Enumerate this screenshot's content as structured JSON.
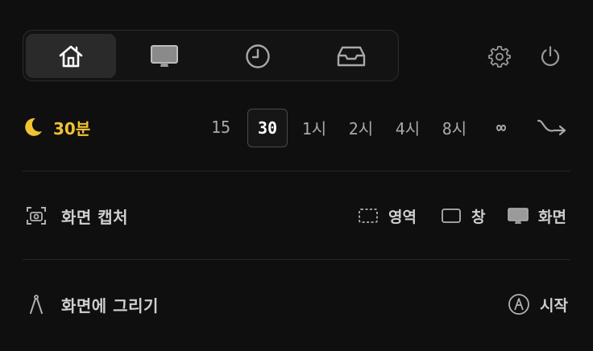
{
  "tabs": [
    {
      "name": "home",
      "icon": "home-icon",
      "active": true
    },
    {
      "name": "display",
      "icon": "monitor-icon",
      "active": false
    },
    {
      "name": "history",
      "icon": "clock-icon",
      "active": false
    },
    {
      "name": "inbox",
      "icon": "inbox-tray-icon",
      "active": false
    }
  ],
  "header": {
    "settings_icon": "gear-icon",
    "power_icon": "power-icon"
  },
  "timer": {
    "icon": "moon-icon",
    "current_label": "30분",
    "options": [
      "15",
      "30",
      "1시",
      "2시",
      "4시",
      "8시",
      "∞"
    ],
    "selected": "30",
    "schedule_icon": "schedule-curve-icon"
  },
  "capture": {
    "icon": "camera-icon",
    "label": "화면 캡처",
    "actions": [
      {
        "icon": "dashed-rect-icon",
        "label": "영역"
      },
      {
        "icon": "window-icon",
        "label": "창"
      },
      {
        "icon": "monitor-icon",
        "label": "화면"
      }
    ]
  },
  "draw": {
    "icon": "compass-icon",
    "label": "화면에 그리기",
    "start_icon": "pen-circle-icon",
    "start_label": "시작"
  },
  "colors": {
    "accent": "#f1c232",
    "background": "#0f0f0f"
  }
}
